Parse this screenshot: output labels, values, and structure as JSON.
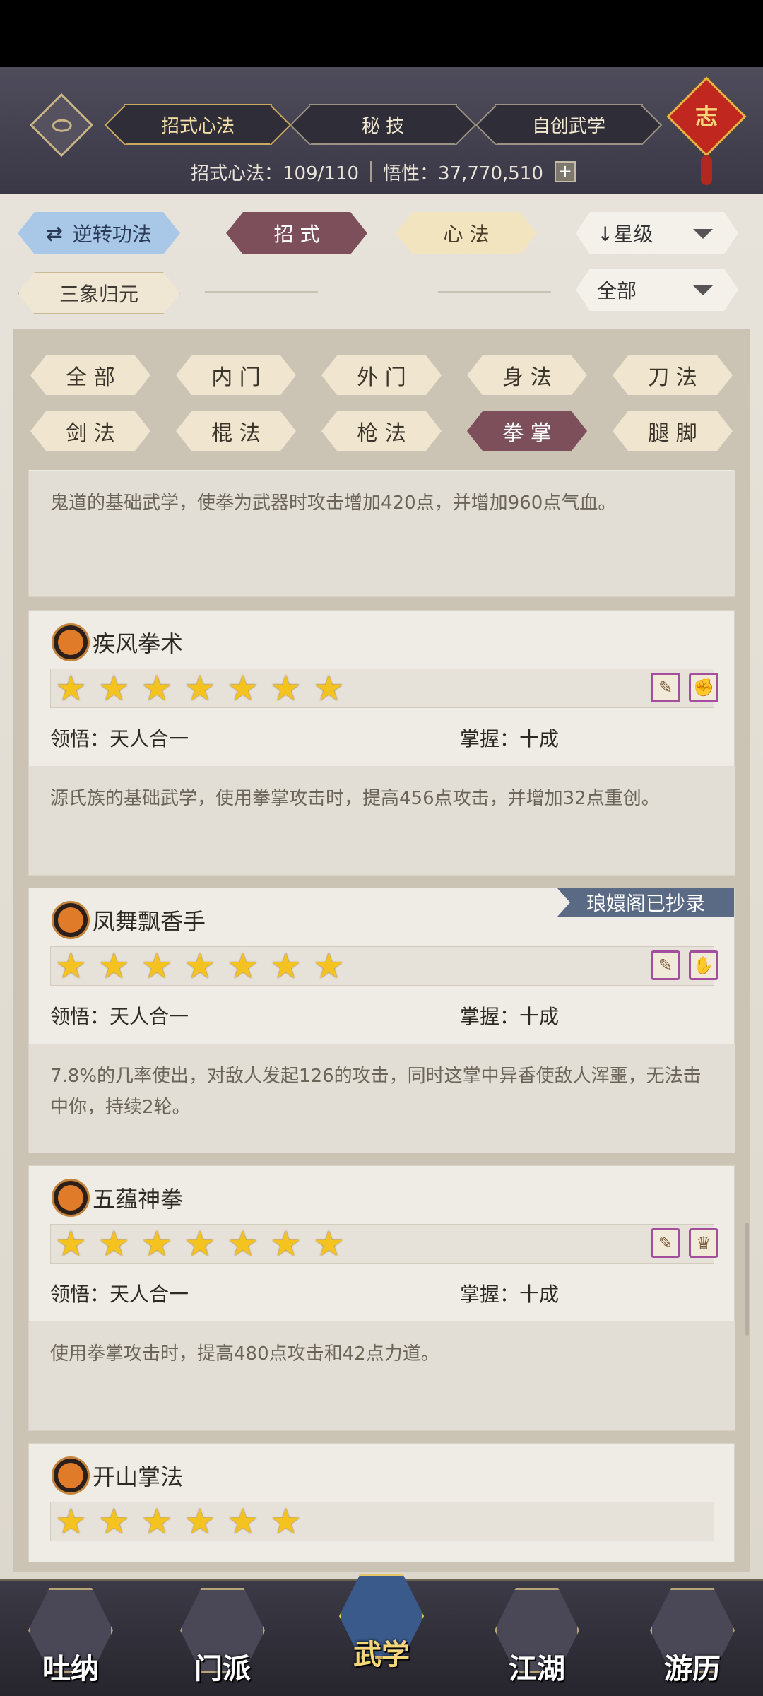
{
  "header": {
    "tabs": [
      {
        "label": "招式心法",
        "active": true
      },
      {
        "label": "秘 技",
        "active": false
      },
      {
        "label": "自创武学",
        "active": false
      }
    ],
    "knot_char": "志",
    "stats": {
      "skills_label": "招式心法：109/110",
      "insight_label": "悟性：37,770,510",
      "plus": "+"
    }
  },
  "controls": {
    "reverse_button": "逆转功法",
    "reverse_icon": "⇄",
    "type_tabs": [
      {
        "label": "招 式",
        "active": true
      },
      {
        "label": "心 法",
        "active": false
      }
    ],
    "sort_dropdown": "↓星级",
    "reset_button": "三象归元",
    "filter_dropdown": "全部"
  },
  "categories": [
    {
      "label": "全 部",
      "active": false
    },
    {
      "label": "内 门",
      "active": false
    },
    {
      "label": "外 门",
      "active": false
    },
    {
      "label": "身 法",
      "active": false
    },
    {
      "label": "刀 法",
      "active": false
    },
    {
      "label": "剑 法",
      "active": false
    },
    {
      "label": "棍 法",
      "active": false
    },
    {
      "label": "枪 法",
      "active": false
    },
    {
      "label": "拳 掌",
      "active": true
    },
    {
      "label": "腿 脚",
      "active": false
    }
  ],
  "skills": [
    {
      "name": "",
      "description": "鬼道的基础武学，使拳为武器时攻击增加420点，并增加960点气血。"
    },
    {
      "name": "疾风拳术",
      "stars": 7,
      "comprehension": "领悟：天人合一",
      "mastery": "掌握：十成",
      "description": "源氏族的基础武学，使用拳掌攻击时，提高456点攻击，并增加32点重创。",
      "ribbon": ""
    },
    {
      "name": "凤舞飘香手",
      "stars": 7,
      "comprehension": "领悟：天人合一",
      "mastery": "掌握：十成",
      "description": "7.8%的几率使出，对敌人发起126的攻击，同时这掌中异香使敌人浑噩，无法击中你，持续2轮。",
      "ribbon": "琅嬛阁已抄录"
    },
    {
      "name": "五蕴神拳",
      "stars": 7,
      "comprehension": "领悟：天人合一",
      "mastery": "掌握：十成",
      "description": "使用拳掌攻击时，提高480点攻击和42点力道。",
      "ribbon": ""
    },
    {
      "name": "开山掌法",
      "stars": 6
    }
  ],
  "star_glyph": "★",
  "nav": [
    {
      "label": "吐纳",
      "active": false
    },
    {
      "label": "门派",
      "active": false
    },
    {
      "label": "武学",
      "active": true
    },
    {
      "label": "江湖",
      "active": false
    },
    {
      "label": "游历",
      "active": false
    }
  ],
  "colors": {
    "accent_maroon": "#7c4f5b",
    "accent_blue": "#a9c7e7",
    "star": "#f4c320",
    "ribbon": "#5a6a84"
  }
}
